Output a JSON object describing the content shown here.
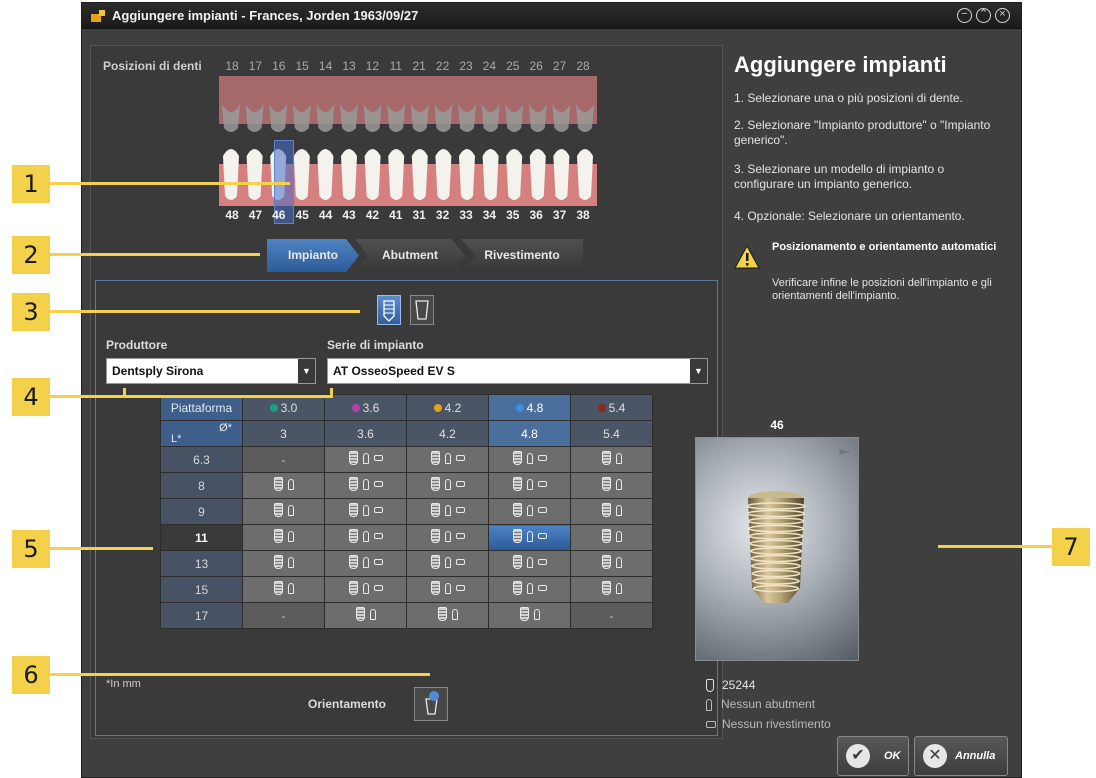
{
  "window": {
    "title": "Aggiungere impianti - Frances, Jorden 1963/09/27",
    "controls": [
      "minimize-icon",
      "maximize-icon",
      "close-icon"
    ]
  },
  "teeth": {
    "label": "Posizioni di denti",
    "upper_numbers": [
      "18",
      "17",
      "16",
      "15",
      "14",
      "13",
      "12",
      "11",
      "21",
      "22",
      "23",
      "24",
      "25",
      "26",
      "27",
      "28"
    ],
    "lower_numbers": [
      "48",
      "47",
      "46",
      "45",
      "44",
      "43",
      "42",
      "41",
      "31",
      "32",
      "33",
      "34",
      "35",
      "36",
      "37",
      "38"
    ],
    "selected": "46"
  },
  "tabs": [
    "Impianto",
    "Abutment",
    "Rivestimento"
  ],
  "form": {
    "produttore_label": "Produttore",
    "produttore_value": "Dentsply Sirona",
    "serie_label": "Serie di impianto",
    "serie_value": "AT OsseoSpeed EV S"
  },
  "table": {
    "platform_label": "Piattaforma",
    "l_label": "L*",
    "d_label": "Ø*",
    "platforms": [
      {
        "label": "3.0",
        "color": "#1aa37a"
      },
      {
        "label": "3.6",
        "color": "#b63fb0"
      },
      {
        "label": "4.2",
        "color": "#e8a21a"
      },
      {
        "label": "4.8",
        "color": "#3b8fe0"
      },
      {
        "label": "5.4",
        "color": "#8a2b1f"
      }
    ],
    "diameters": [
      "3",
      "3.6",
      "4.2",
      "4.8",
      "5.4"
    ],
    "selected_col": 3,
    "rows": [
      {
        "length": "6.3",
        "cells": [
          "-",
          "iac",
          "iac",
          "iac",
          "ia"
        ]
      },
      {
        "length": "8",
        "cells": [
          "ia",
          "iac",
          "iac",
          "iac",
          "ia"
        ]
      },
      {
        "length": "9",
        "cells": [
          "ia",
          "iac",
          "iac",
          "iac",
          "ia"
        ]
      },
      {
        "length": "11",
        "cells": [
          "ia",
          "iac",
          "iac",
          "iac*",
          "ia"
        ]
      },
      {
        "length": "13",
        "cells": [
          "ia",
          "iac",
          "iac",
          "iac",
          "ia"
        ]
      },
      {
        "length": "15",
        "cells": [
          "ia",
          "iac",
          "iac",
          "iac",
          "ia"
        ]
      },
      {
        "length": "17",
        "cells": [
          "-",
          "ia",
          "ia",
          "ia",
          "-"
        ]
      }
    ],
    "selected_row": 3,
    "note": "*In mm"
  },
  "orientation_label": "Orientamento",
  "help": {
    "title": "Aggiungere impianti",
    "steps": [
      "1. Selezionare una o più posizioni di dente.",
      "2. Selezionare \"Impianto produttore\" o \"Impianto generico\".",
      "3. Selezionare un modello di impianto o configurare un impianto generico.",
      "4. Opzionale: Selezionare un orientamento."
    ],
    "warning_title": "Posizionamento e orientamento automatici",
    "warning_text": "Verificare infine le posizioni dell'impianto e gli orientamenti dell'impianto."
  },
  "preview": {
    "tooth": "46",
    "implant_code": "25244",
    "abutment": "Nessun abutment",
    "covering": "Nessun rivestimento"
  },
  "buttons": {
    "ok": "OK",
    "cancel": "Annulla"
  },
  "callouts": [
    "1",
    "2",
    "3",
    "4",
    "5",
    "6",
    "7"
  ]
}
